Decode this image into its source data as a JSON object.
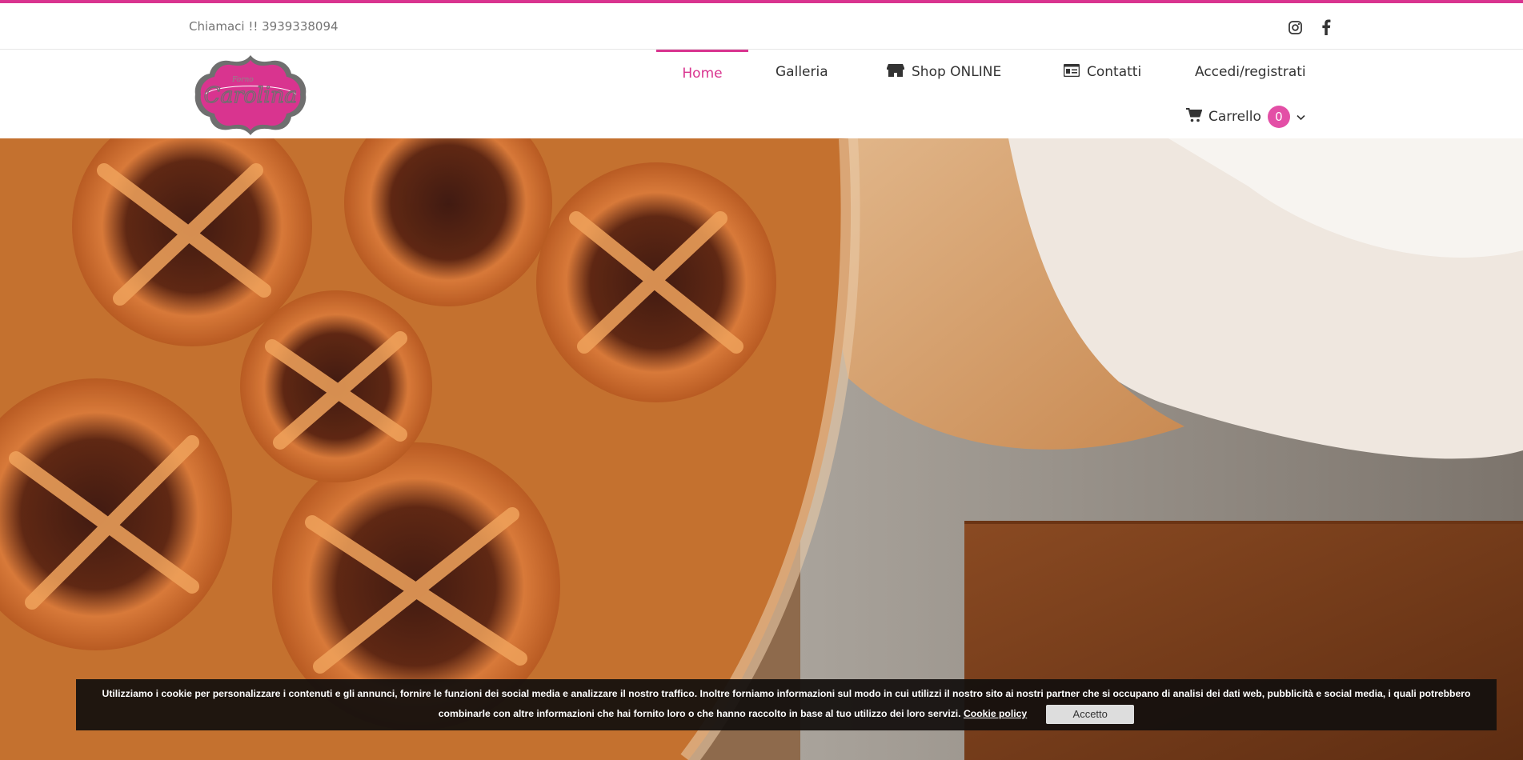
{
  "colors": {
    "accent": "#d9348f",
    "badge": "#e34fa6",
    "cookie_bg": "#14100e"
  },
  "topbar": {
    "phone": "Chiamaci !! 3939338094",
    "social": [
      "instagram-icon",
      "facebook-icon"
    ]
  },
  "header": {
    "logo_text": "Carolina",
    "logo_small": "Forno",
    "nav": {
      "home": "Home",
      "gallery": "Galleria",
      "shop": "Shop ONLINE",
      "contacts": "Contatti",
      "login": "Accedi/registrati"
    },
    "cart": {
      "label": "Carrello",
      "count": "0"
    }
  },
  "hero": {
    "image": "tarts-crostata-photo"
  },
  "cookie": {
    "line1": "Utilizziamo i cookie per personalizzare i contenuti e gli annunci, fornire le funzioni dei social media e analizzare il nostro traffico. Inoltre forniamo informazioni sul modo in cui utilizzi il nostro sito ai nostri partner che si occupano di analisi dei dati web, pubblicità e social media, i quali potrebbero",
    "line2": "combinarle con altre informazioni che hai fornito loro o che hanno raccolto in base al tuo utilizzo dei loro servizi.",
    "policy_link": "Cookie policy",
    "accept": "Accetto"
  }
}
